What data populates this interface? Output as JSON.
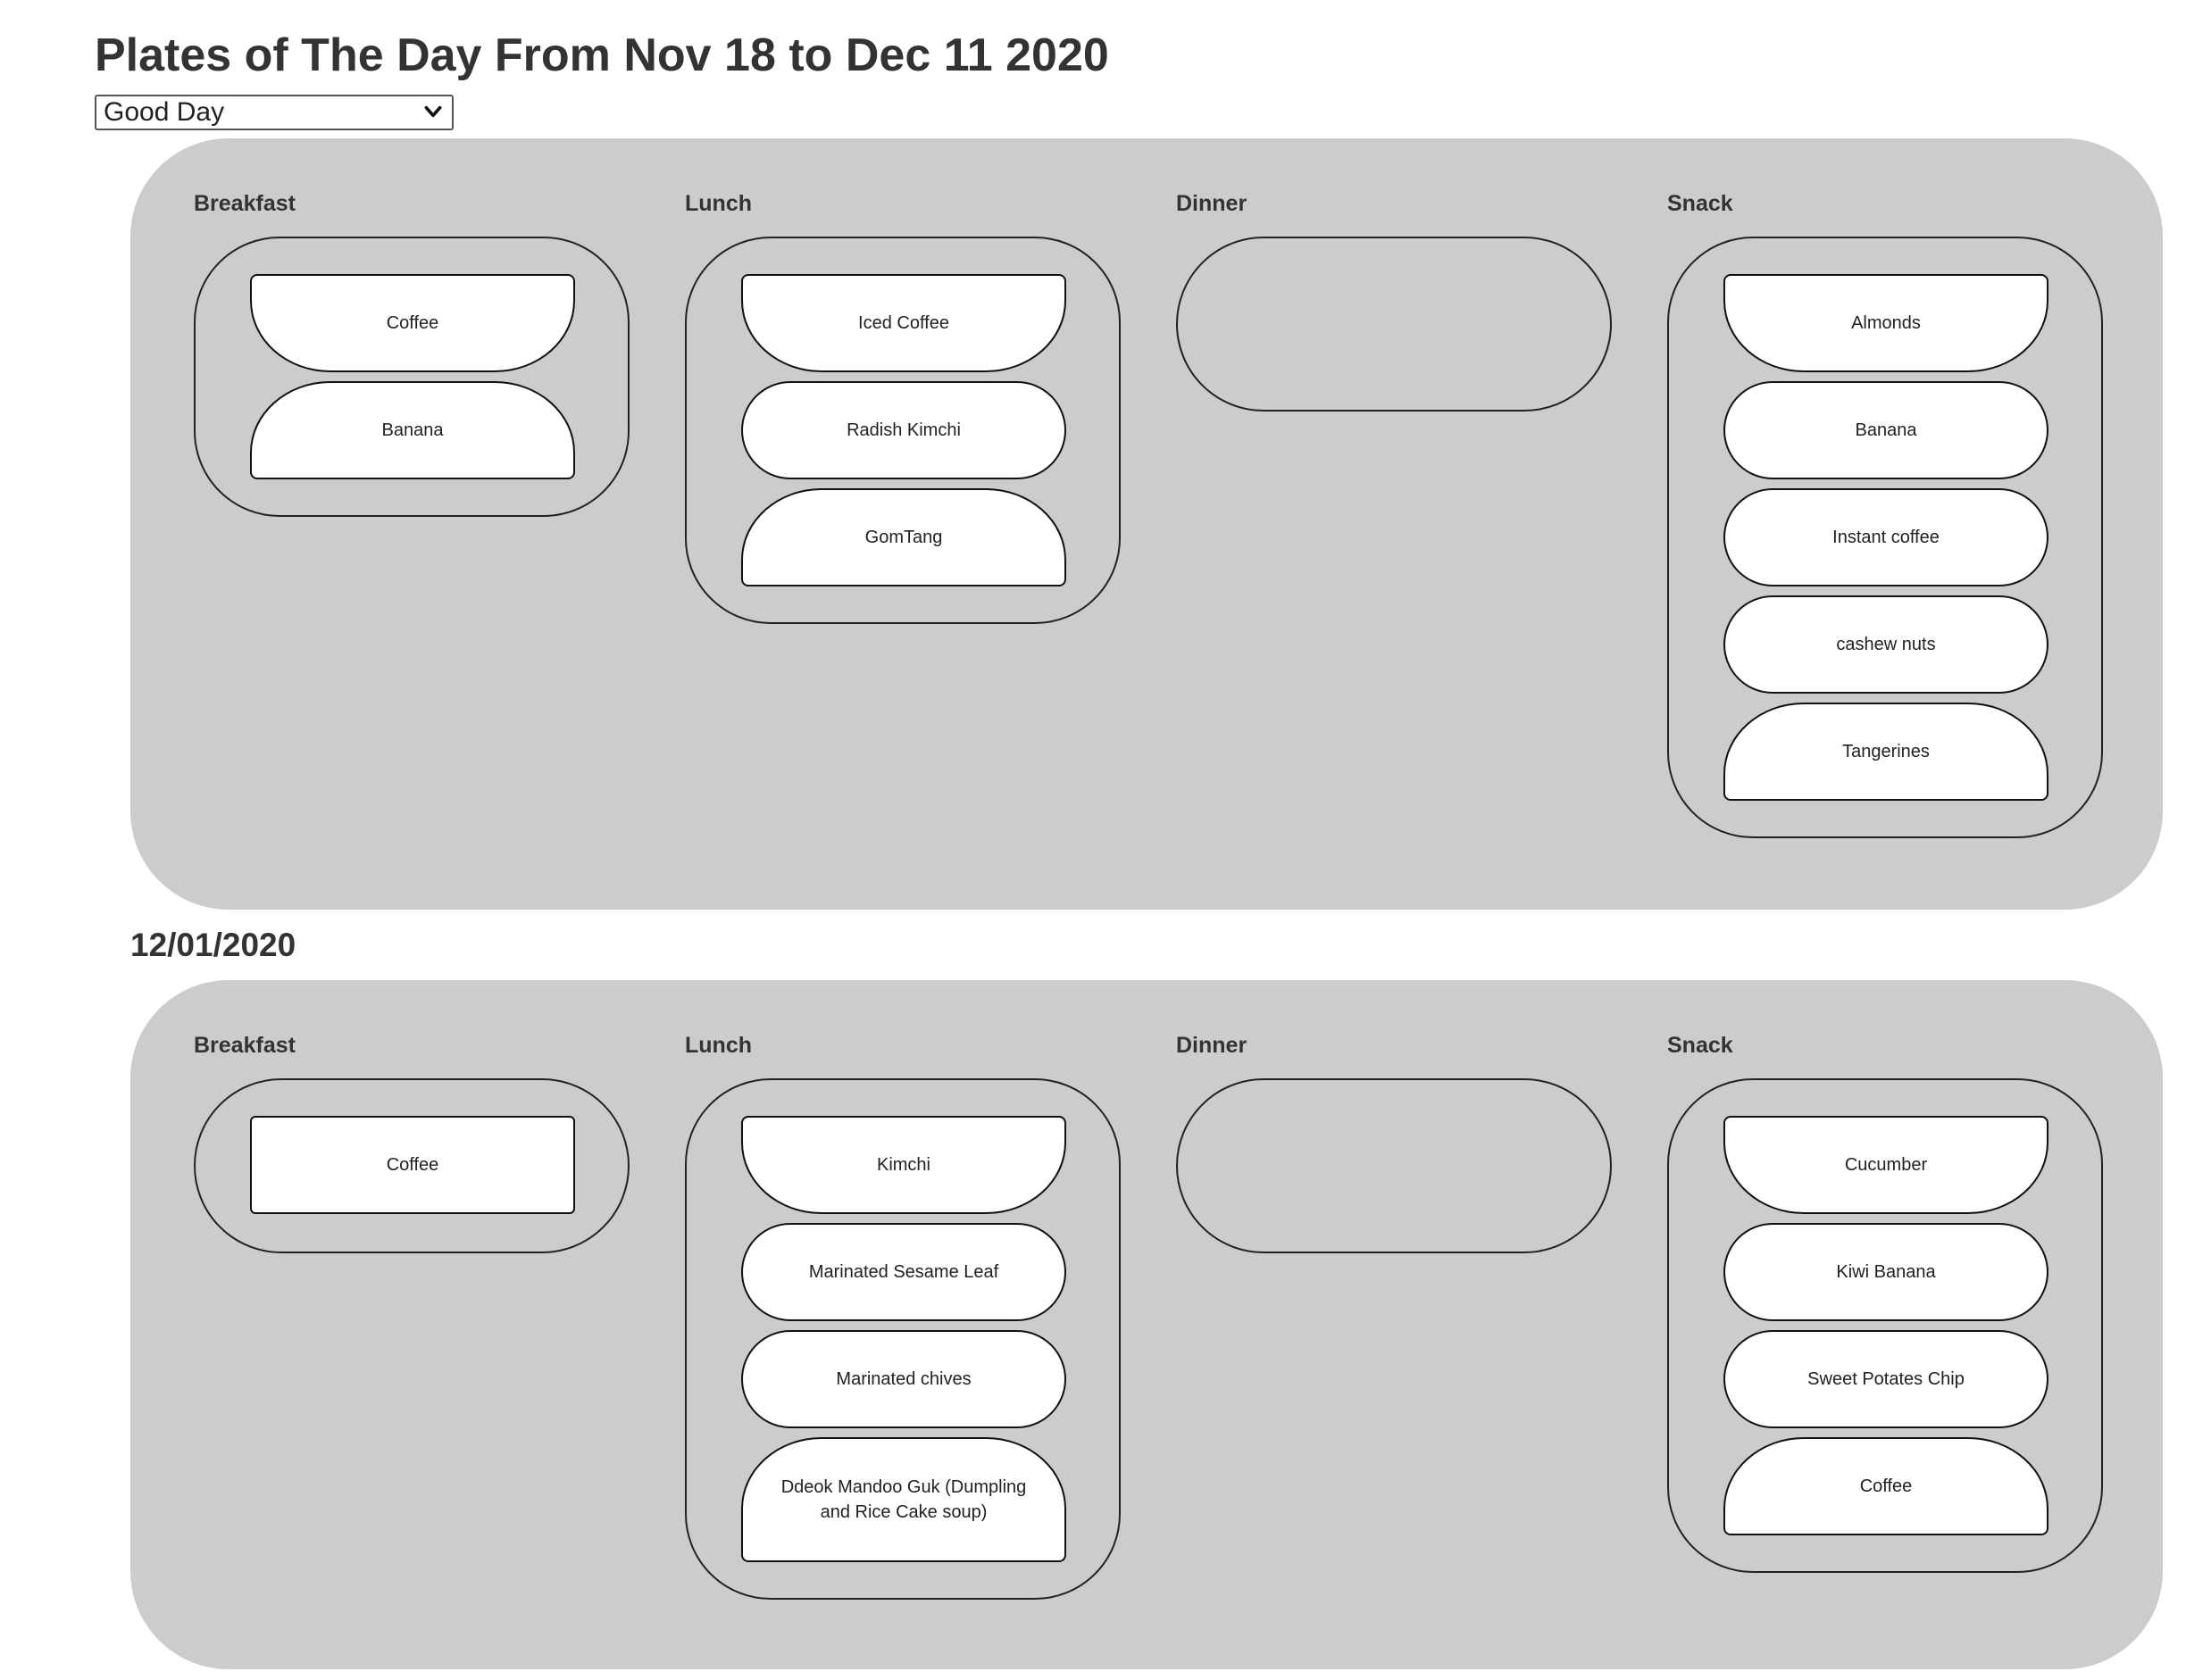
{
  "header": {
    "title": "Plates of The Day From Nov 18 to Dec 11 2020"
  },
  "filter": {
    "selected": "Good Day"
  },
  "days": [
    {
      "date": "",
      "meals": {
        "breakfast": {
          "label": "Breakfast",
          "items": [
            "Coffee",
            "Banana"
          ]
        },
        "lunch": {
          "label": "Lunch",
          "items": [
            "Iced Coffee",
            "Radish Kimchi",
            "GomTang"
          ]
        },
        "dinner": {
          "label": "Dinner",
          "items": []
        },
        "snack": {
          "label": "Snack",
          "items": [
            "Almonds",
            "Banana",
            "Instant coffee",
            "cashew nuts",
            "Tangerines"
          ]
        }
      }
    },
    {
      "date": "12/01/2020",
      "meals": {
        "breakfast": {
          "label": "Breakfast",
          "items": [
            "Coffee"
          ]
        },
        "lunch": {
          "label": "Lunch",
          "items": [
            "Kimchi",
            "Marinated Sesame Leaf",
            "Marinated chives",
            "Ddeok Mandoo Guk (Dumpling and Rice Cake soup)"
          ]
        },
        "dinner": {
          "label": "Dinner",
          "items": []
        },
        "snack": {
          "label": "Snack",
          "items": [
            "Cucumber",
            "Kiwi Banana",
            "Sweet Potates Chip",
            "Coffee"
          ]
        }
      }
    }
  ]
}
